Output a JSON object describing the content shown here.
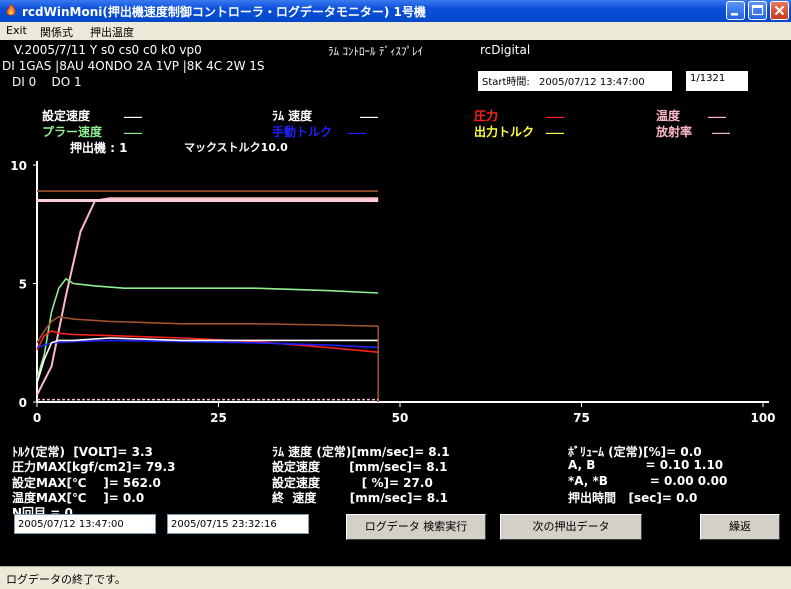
{
  "window": {
    "title": "rcdWinMoni(押出機速度制御コントローラ・ログデータモニター) 1号機"
  },
  "menu": [
    "Exit",
    "関係式",
    "押出温度"
  ],
  "info": {
    "line1": "V.2005/7/11 Y s0 cs0 c0 k0 vp0",
    "display_title": "ﾗﾑ ｺﾝﾄﾛｰﾙ ﾃﾞｨｽﾌﾟﾚｲ",
    "brand": "rcDigital",
    "line2": "DI 1GAS |8AU 4ONDO 2A 1VP |8K 4C 2W 1S",
    "line3": "DI 0    DO 1",
    "start_label": "Start時間:",
    "start_value": "2005/07/12 13:47:00",
    "page": "1/1321"
  },
  "legend": {
    "set_speed": "設定速度",
    "ram_speed": "ﾗﾑ 速度",
    "pressure": "圧力",
    "temperature": "温度",
    "puller_speed": "プラー速度",
    "manual_torque": "手動トルク",
    "output_torque": "出力トルク",
    "radiation": "放射率",
    "extruder": "押出機 : 1",
    "max_torque": "マックストルク10.0",
    "swatch": "___"
  },
  "colors": {
    "set_speed": "#ffffff",
    "ram_speed": "#ffffff",
    "pressure": "#ff2020",
    "temperature": "#ffb8c8",
    "puller_speed": "#90ee90",
    "manual_torque": "#2020ff",
    "output_torque": "#ffff40",
    "radiation": "#ffb8c8",
    "brown": "#a0522d"
  },
  "chart_data": {
    "type": "line",
    "xlim": [
      0,
      100
    ],
    "ylim": [
      0,
      10
    ],
    "x_ticks": [
      "0",
      "25",
      "50",
      "75",
      "100"
    ],
    "y_ticks": [
      "0",
      "5",
      "10"
    ],
    "series": [
      {
        "key": "temperature",
        "x": [
          0,
          2,
          4,
          6,
          8,
          10,
          15,
          20,
          30,
          40,
          47
        ],
        "values": [
          0.3,
          1.5,
          4.5,
          7.2,
          8.5,
          8.6,
          8.6,
          8.6,
          8.6,
          8.6,
          8.6
        ]
      },
      {
        "key": "puller_speed",
        "x": [
          0,
          1,
          2,
          3,
          4,
          5,
          8,
          12,
          20,
          30,
          40,
          47
        ],
        "values": [
          1.0,
          2.0,
          3.8,
          4.8,
          5.2,
          5.0,
          4.9,
          4.8,
          4.8,
          4.8,
          4.7,
          4.6
        ]
      },
      {
        "key": "pressure",
        "x": [
          0,
          1,
          2,
          3,
          5,
          10,
          20,
          30,
          40,
          47
        ],
        "values": [
          2.2,
          2.8,
          3.0,
          2.9,
          2.85,
          2.8,
          2.7,
          2.55,
          2.3,
          2.1
        ]
      },
      {
        "key": "manual_torque",
        "x": [
          0,
          2,
          5,
          10,
          20,
          30,
          40,
          47
        ],
        "values": [
          2.3,
          2.5,
          2.55,
          2.6,
          2.55,
          2.5,
          2.4,
          2.3
        ]
      },
      {
        "key": "set_speed",
        "x": [
          0,
          1,
          2,
          3,
          5,
          10,
          20,
          30,
          40,
          47
        ],
        "values": [
          0.8,
          1.8,
          2.5,
          2.6,
          2.6,
          2.7,
          2.6,
          2.6,
          2.6,
          2.6
        ]
      },
      {
        "key": "brown_upper",
        "x": [
          0,
          47
        ],
        "values": [
          8.9,
          8.9
        ]
      },
      {
        "key": "brown_step",
        "x": [
          0,
          1,
          2,
          3,
          5,
          10,
          20,
          30,
          40,
          47
        ],
        "values": [
          2.5,
          3.0,
          3.4,
          3.6,
          3.5,
          3.4,
          3.3,
          3.3,
          3.25,
          3.2
        ]
      }
    ]
  },
  "readings": {
    "torque": "ﾄﾙｸ(定常)  [VOLT]= 3.3",
    "pressure_max": "圧力MAX[kgf/cm2]= 79.3",
    "set_max": "設定MAX[℃    ]= 562.0",
    "temp_max": "温度MAX[℃    ]= 0.0",
    "n_cycle": "N回目 = 0",
    "ram_speed": "ﾗﾑ 速度 (定常)[mm/sec]= 8.1",
    "set_speed1": "設定速度       [mm/sec]= 8.1",
    "set_speed2": "設定速度          [ %]= 27.0",
    "final_speed": "終  速度        [mm/sec]= 8.1",
    "volume": "ﾎﾞﾘｭｰﾑ (定常)[%]= 0.0",
    "ab": "A, B            = 0.10 1.10",
    "ab2": "*A, *B          = 0.00 0.00",
    "extrude_time": "押出時間   [sec]= 0.0"
  },
  "controls": {
    "date_from": "2005/07/12 13:47:00",
    "date_to": "2005/07/15 23:32:16",
    "search_button": "ログデータ 検索実行",
    "next_button": "次の押出データ",
    "repeat_button": "繰返"
  },
  "status": "ログデータの終了です。"
}
